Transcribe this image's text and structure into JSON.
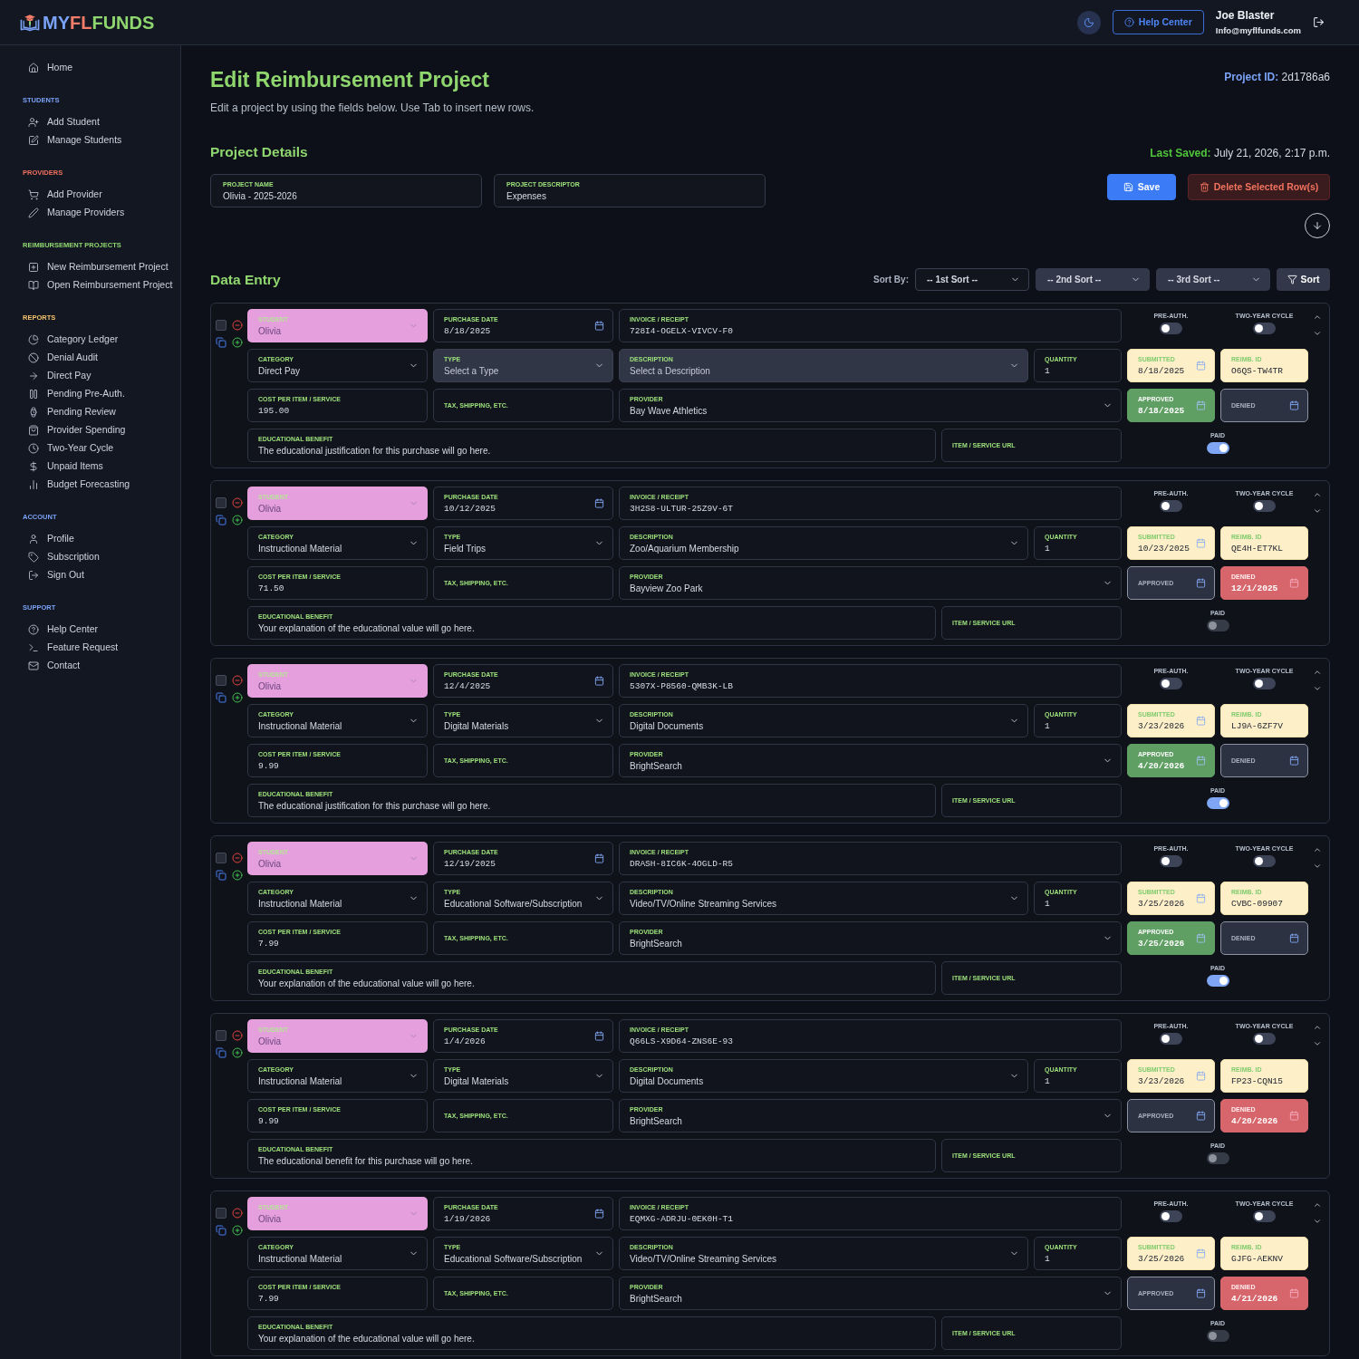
{
  "header": {
    "logo": [
      "MY",
      "FL",
      "FUNDS"
    ],
    "help_button": "Help Center",
    "user": {
      "name": "Joe Blaster",
      "email": "Info@myflfunds.com"
    }
  },
  "sidebar": {
    "items": [
      {
        "label": "Home"
      }
    ],
    "sections": [
      {
        "heading": "STUDENTS",
        "color": "#7aa2f7",
        "items": [
          {
            "label": "Add Student"
          },
          {
            "label": "Manage Students"
          }
        ]
      },
      {
        "heading": "PROVIDERS",
        "color": "#f0705e",
        "items": [
          {
            "label": "Add Provider"
          },
          {
            "label": "Manage Providers"
          }
        ]
      },
      {
        "heading": "REIMBURSEMENT PROJECTS",
        "color": "#8fd66f",
        "items": [
          {
            "label": "New Reimbursement Project"
          },
          {
            "label": "Open Reimbursement Project"
          }
        ]
      },
      {
        "heading": "REPORTS",
        "color": "#f5c26b",
        "items": [
          {
            "label": "Category Ledger"
          },
          {
            "label": "Denial Audit"
          },
          {
            "label": "Direct Pay"
          },
          {
            "label": "Pending Pre-Auth."
          },
          {
            "label": "Pending Review"
          },
          {
            "label": "Provider Spending"
          },
          {
            "label": "Two-Year Cycle"
          },
          {
            "label": "Unpaid Items"
          },
          {
            "label": "Budget Forecasting"
          }
        ]
      },
      {
        "heading": "ACCOUNT",
        "color": "#7aa2f7",
        "items": [
          {
            "label": "Profile"
          },
          {
            "label": "Subscription"
          },
          {
            "label": "Sign Out"
          }
        ]
      },
      {
        "heading": "SUPPORT",
        "color": "#7aa2f7",
        "items": [
          {
            "label": "Help Center"
          },
          {
            "label": "Feature Request"
          },
          {
            "label": "Contact"
          }
        ]
      }
    ]
  },
  "page": {
    "title": "Edit Reimbursement Project",
    "subtitle": "Edit a project by using the fields below. Use Tab to insert new rows.",
    "project_id": {
      "label": "Project ID:",
      "value": "2d1786a6"
    }
  },
  "project_details": {
    "heading": "Project Details",
    "last_saved": {
      "label": "Last Saved:",
      "value": "July 21, 2026, 2:17 p.m."
    },
    "fields": [
      {
        "label": "PROJECT NAME",
        "value": "Olivia - 2025-2026"
      },
      {
        "label": "PROJECT DESCRIPTOR",
        "value": "Expenses"
      }
    ],
    "buttons": [
      {
        "kind": "save",
        "label": "Save"
      },
      {
        "kind": "delete",
        "label": "Delete Selected Row(s)"
      }
    ]
  },
  "data_entry": {
    "heading": "Data Entry",
    "sort_label": "Sort By:",
    "sorts": [
      {
        "value": "-- 1st Sort --",
        "disabled": false
      },
      {
        "value": "-- 2nd Sort --",
        "disabled": true
      },
      {
        "value": "-- 3rd Sort --",
        "disabled": true
      }
    ],
    "sort_button": "Sort",
    "rows": [
      {
        "selected": false,
        "student": {
          "label": "STUDENT",
          "value": "Olivia",
          "color": "#e59fdc",
          "disabled": true
        },
        "purchase_date": {
          "label": "PURCHASE DATE",
          "value": "8/18/2025"
        },
        "invoice": {
          "label": "INVOICE / RECEIPT",
          "value": "728I4-OGELX-VIVCV-F0"
        },
        "pre_auth": {
          "label": "PRE-AUTH.",
          "on": false
        },
        "two_year_cycle": {
          "label": "TWO-YEAR CYCLE",
          "on": false
        },
        "category": {
          "label": "CATEGORY",
          "value": "Direct Pay"
        },
        "type": {
          "label": "TYPE",
          "placeholder": "Select a Type"
        },
        "description": {
          "label": "DESCRIPTION",
          "placeholder": "Select a Description"
        },
        "quantity": {
          "label": "QUANTITY",
          "value": "1"
        },
        "submitted": {
          "label": "SUBMITTED",
          "value": "8/18/2025"
        },
        "reimb_id": {
          "label": "REIMB. ID",
          "value": "O6QS-TW4TR"
        },
        "cost": {
          "label": "COST PER ITEM / SERVICE",
          "value": "195.00"
        },
        "tax": {
          "label": "TAX, SHIPPING, ETC."
        },
        "provider": {
          "label": "PROVIDER",
          "value": "Bay Wave Athletics"
        },
        "approved": {
          "label": "APPROVED",
          "value": "8/18/2025"
        },
        "denied": {
          "label": "DENIED"
        },
        "benefit": {
          "label": "EDUCATIONAL BENEFIT",
          "value": "The educational justification for this purchase will go here."
        },
        "item_url": {
          "label": "ITEM / SERVICE URL"
        },
        "paid": {
          "label": "PAID",
          "on": true,
          "disabled": false
        }
      },
      {
        "selected": false,
        "student": {
          "label": "STUDENT",
          "value": "Olivia",
          "color": "#e59fdc",
          "disabled": true
        },
        "purchase_date": {
          "label": "PURCHASE DATE",
          "value": "10/12/2025"
        },
        "invoice": {
          "label": "INVOICE / RECEIPT",
          "value": "3H2S8-ULTUR-25Z9V-6T"
        },
        "pre_auth": {
          "label": "PRE-AUTH.",
          "on": false
        },
        "two_year_cycle": {
          "label": "TWO-YEAR CYCLE",
          "on": false
        },
        "category": {
          "label": "CATEGORY",
          "value": "Instructional Material"
        },
        "type": {
          "label": "TYPE",
          "value": "Field Trips"
        },
        "description": {
          "label": "DESCRIPTION",
          "value": "Zoo/Aquarium Membership"
        },
        "quantity": {
          "label": "QUANTITY",
          "value": "1"
        },
        "submitted": {
          "label": "SUBMITTED",
          "value": "10/23/2025"
        },
        "reimb_id": {
          "label": "REIMB. ID",
          "value": "QE4H-ET7KL"
        },
        "cost": {
          "label": "COST PER ITEM / SERVICE",
          "value": "71.50"
        },
        "tax": {
          "label": "TAX, SHIPPING, ETC."
        },
        "provider": {
          "label": "PROVIDER",
          "value": "Bayview Zoo Park"
        },
        "approved": {
          "label": "APPROVED"
        },
        "denied": {
          "label": "DENIED",
          "value": "12/1/2025"
        },
        "benefit": {
          "label": "EDUCATIONAL BENEFIT",
          "value": "Your explanation of the educational value will go here."
        },
        "item_url": {
          "label": "ITEM / SERVICE URL"
        },
        "paid": {
          "label": "PAID",
          "on": false,
          "disabled": true
        }
      },
      {
        "selected": false,
        "student": {
          "label": "STUDENT",
          "value": "Olivia",
          "color": "#e59fdc",
          "disabled": true
        },
        "purchase_date": {
          "label": "PURCHASE DATE",
          "value": "12/4/2025"
        },
        "invoice": {
          "label": "INVOICE / RECEIPT",
          "value": "5307X-P8560-QMB3K-LB"
        },
        "pre_auth": {
          "label": "PRE-AUTH.",
          "on": false
        },
        "two_year_cycle": {
          "label": "TWO-YEAR CYCLE",
          "on": false
        },
        "category": {
          "label": "CATEGORY",
          "value": "Instructional Material"
        },
        "type": {
          "label": "TYPE",
          "value": "Digital Materials"
        },
        "description": {
          "label": "DESCRIPTION",
          "value": "Digital Documents"
        },
        "quantity": {
          "label": "QUANTITY",
          "value": "1"
        },
        "submitted": {
          "label": "SUBMITTED",
          "value": "3/23/2026"
        },
        "reimb_id": {
          "label": "REIMB. ID",
          "value": "LJ9A-6ZF7V"
        },
        "cost": {
          "label": "COST PER ITEM / SERVICE",
          "value": "9.99"
        },
        "tax": {
          "label": "TAX, SHIPPING, ETC."
        },
        "provider": {
          "label": "PROVIDER",
          "value": "BrightSearch"
        },
        "approved": {
          "label": "APPROVED",
          "value": "4/20/2026"
        },
        "denied": {
          "label": "DENIED"
        },
        "benefit": {
          "label": "EDUCATIONAL BENEFIT",
          "value": "The educational justification for this purchase will go here."
        },
        "item_url": {
          "label": "ITEM / SERVICE URL"
        },
        "paid": {
          "label": "PAID",
          "on": true,
          "disabled": false
        }
      },
      {
        "selected": false,
        "student": {
          "label": "STUDENT",
          "value": "Olivia",
          "color": "#e59fdc",
          "disabled": true
        },
        "purchase_date": {
          "label": "PURCHASE DATE",
          "value": "12/19/2025"
        },
        "invoice": {
          "label": "INVOICE / RECEIPT",
          "value": "DRASH-8IC6K-4OGLD-R5"
        },
        "pre_auth": {
          "label": "PRE-AUTH.",
          "on": false
        },
        "two_year_cycle": {
          "label": "TWO-YEAR CYCLE",
          "on": false
        },
        "category": {
          "label": "CATEGORY",
          "value": "Instructional Material"
        },
        "type": {
          "label": "TYPE",
          "value": "Educational Software/Subscription"
        },
        "description": {
          "label": "DESCRIPTION",
          "value": "Video/TV/Online Streaming Services"
        },
        "quantity": {
          "label": "QUANTITY",
          "value": "1"
        },
        "submitted": {
          "label": "SUBMITTED",
          "value": "3/25/2026"
        },
        "reimb_id": {
          "label": "REIMB. ID",
          "value": "CVBC-09907"
        },
        "cost": {
          "label": "COST PER ITEM / SERVICE",
          "value": "7.99"
        },
        "tax": {
          "label": "TAX, SHIPPING, ETC."
        },
        "provider": {
          "label": "PROVIDER",
          "value": "BrightSearch"
        },
        "approved": {
          "label": "APPROVED",
          "value": "3/25/2026"
        },
        "denied": {
          "label": "DENIED"
        },
        "benefit": {
          "label": "EDUCATIONAL BENEFIT",
          "value": "Your explanation of the educational value will go here."
        },
        "item_url": {
          "label": "ITEM / SERVICE URL"
        },
        "paid": {
          "label": "PAID",
          "on": true,
          "disabled": false
        }
      },
      {
        "selected": false,
        "student": {
          "label": "STUDENT",
          "value": "Olivia",
          "color": "#e59fdc",
          "disabled": true
        },
        "purchase_date": {
          "label": "PURCHASE DATE",
          "value": "1/4/2026"
        },
        "invoice": {
          "label": "INVOICE / RECEIPT",
          "value": "Q66LS-X9D64-ZNS6E-93"
        },
        "pre_auth": {
          "label": "PRE-AUTH.",
          "on": false
        },
        "two_year_cycle": {
          "label": "TWO-YEAR CYCLE",
          "on": false
        },
        "category": {
          "label": "CATEGORY",
          "value": "Instructional Material"
        },
        "type": {
          "label": "TYPE",
          "value": "Digital Materials"
        },
        "description": {
          "label": "DESCRIPTION",
          "value": "Digital Documents"
        },
        "quantity": {
          "label": "QUANTITY",
          "value": "1"
        },
        "submitted": {
          "label": "SUBMITTED",
          "value": "3/23/2026"
        },
        "reimb_id": {
          "label": "REIMB. ID",
          "value": "FP23-CQN15"
        },
        "cost": {
          "label": "COST PER ITEM / SERVICE",
          "value": "9.99"
        },
        "tax": {
          "label": "TAX, SHIPPING, ETC."
        },
        "provider": {
          "label": "PROVIDER",
          "value": "BrightSearch"
        },
        "approved": {
          "label": "APPROVED"
        },
        "denied": {
          "label": "DENIED",
          "value": "4/20/2026"
        },
        "benefit": {
          "label": "EDUCATIONAL BENEFIT",
          "value": "The educational benefit for this purchase will go here."
        },
        "item_url": {
          "label": "ITEM / SERVICE URL"
        },
        "paid": {
          "label": "PAID",
          "on": false,
          "disabled": true
        }
      },
      {
        "selected": false,
        "student": {
          "label": "STUDENT",
          "value": "Olivia",
          "color": "#e59fdc",
          "disabled": true
        },
        "purchase_date": {
          "label": "PURCHASE DATE",
          "value": "1/19/2026"
        },
        "invoice": {
          "label": "INVOICE / RECEIPT",
          "value": "EQMXG-ADRJU-0EK0H-T1"
        },
        "pre_auth": {
          "label": "PRE-AUTH.",
          "on": false
        },
        "two_year_cycle": {
          "label": "TWO-YEAR CYCLE",
          "on": false
        },
        "category": {
          "label": "CATEGORY",
          "value": "Instructional Material"
        },
        "type": {
          "label": "TYPE",
          "value": "Educational Software/Subscription"
        },
        "description": {
          "label": "DESCRIPTION",
          "value": "Video/TV/Online Streaming Services"
        },
        "quantity": {
          "label": "QUANTITY",
          "value": "1"
        },
        "submitted": {
          "label": "SUBMITTED",
          "value": "3/25/2026"
        },
        "reimb_id": {
          "label": "REIMB. ID",
          "value": "GJFG-AEKNV"
        },
        "cost": {
          "label": "COST PER ITEM / SERVICE",
          "value": "7.99"
        },
        "tax": {
          "label": "TAX, SHIPPING, ETC."
        },
        "provider": {
          "label": "PROVIDER",
          "value": "BrightSearch"
        },
        "approved": {
          "label": "APPROVED"
        },
        "denied": {
          "label": "DENIED",
          "value": "4/21/2026"
        },
        "benefit": {
          "label": "EDUCATIONAL BENEFIT",
          "value": "Your explanation of the educational value will go here."
        },
        "item_url": {
          "label": "ITEM / SERVICE URL"
        },
        "paid": {
          "label": "PAID",
          "on": false,
          "disabled": true
        }
      }
    ]
  }
}
